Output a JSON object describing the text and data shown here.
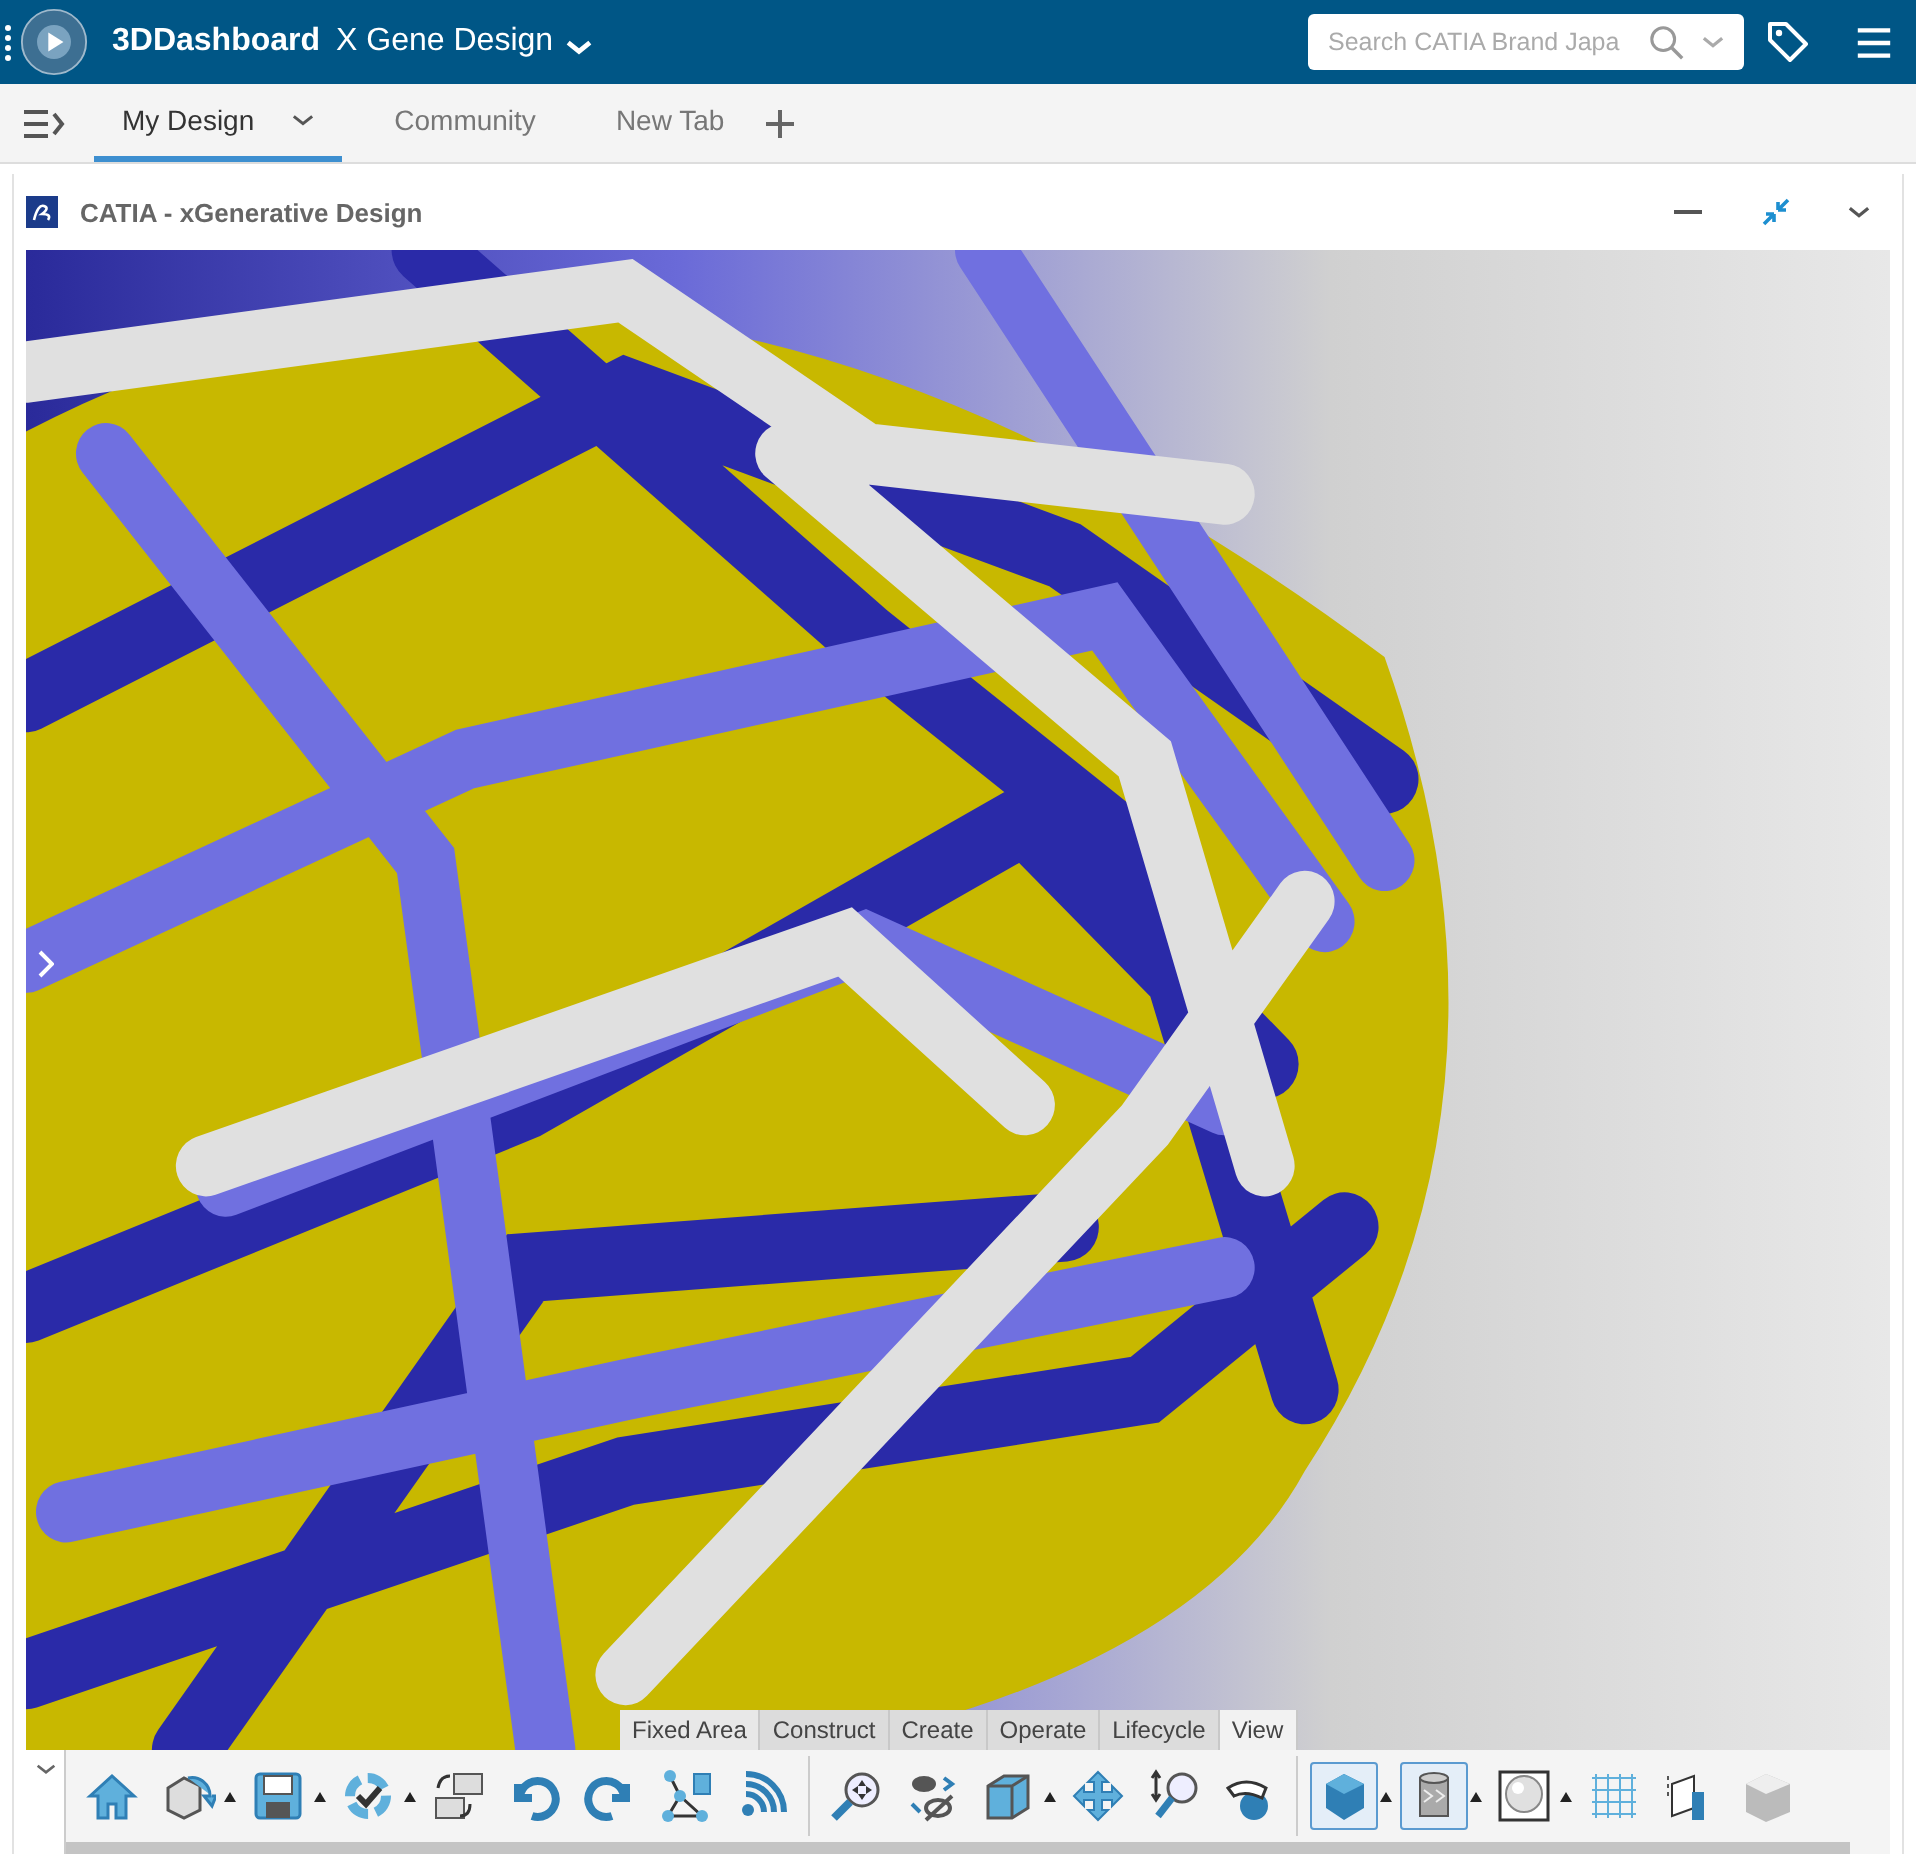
{
  "topbar": {
    "app": "3DDashboard",
    "dashboard": "X Gene Design",
    "search": {
      "placeholder": "Search CATIA Brand Japa"
    }
  },
  "tabs": [
    {
      "label": "My Design",
      "selected": true
    },
    {
      "label": "Community",
      "selected": false
    },
    {
      "label": "New Tab",
      "selected": false
    }
  ],
  "widget": {
    "title": "CATIA - xGenerative Design"
  },
  "toolbar": {
    "sections": [
      {
        "label": "Fixed Area",
        "selected": false
      },
      {
        "label": "Construct",
        "selected": false
      },
      {
        "label": "Create",
        "selected": false
      },
      {
        "label": "Operate",
        "selected": false
      },
      {
        "label": "Lifecycle",
        "selected": false
      },
      {
        "label": "View",
        "selected": true
      }
    ],
    "tools": [
      {
        "kind": "home",
        "pressed": false,
        "has_menu": false
      },
      {
        "kind": "part",
        "pressed": false,
        "has_menu": true
      },
      {
        "kind": "save",
        "pressed": false,
        "has_menu": true
      },
      {
        "kind": "update",
        "pressed": false,
        "has_menu": true
      },
      {
        "kind": "swap",
        "pressed": false,
        "has_menu": false
      },
      {
        "kind": "undo",
        "pressed": false,
        "has_menu": false
      },
      {
        "kind": "redo",
        "pressed": false,
        "has_menu": false
      },
      {
        "kind": "graph",
        "pressed": false,
        "has_menu": false
      },
      {
        "kind": "signal",
        "pressed": false,
        "has_menu": false
      },
      {
        "kind": "separator"
      },
      {
        "kind": "fit",
        "pressed": false,
        "has_menu": false
      },
      {
        "kind": "hide",
        "pressed": false,
        "has_menu": false
      },
      {
        "kind": "box",
        "pressed": false,
        "has_menu": true
      },
      {
        "kind": "pan",
        "pressed": false,
        "has_menu": false
      },
      {
        "kind": "zoom",
        "pressed": false,
        "has_menu": false
      },
      {
        "kind": "rotate",
        "pressed": false,
        "has_menu": false
      },
      {
        "kind": "separator"
      },
      {
        "kind": "shaded",
        "pressed": true,
        "has_menu": true
      },
      {
        "kind": "cylinder",
        "pressed": true,
        "has_menu": true
      },
      {
        "kind": "sphere",
        "pressed": false,
        "has_menu": true
      },
      {
        "kind": "grid",
        "pressed": false,
        "has_menu": false
      },
      {
        "kind": "section",
        "pressed": false,
        "has_menu": false
      },
      {
        "kind": "solid",
        "pressed": false,
        "has_menu": false
      }
    ]
  }
}
